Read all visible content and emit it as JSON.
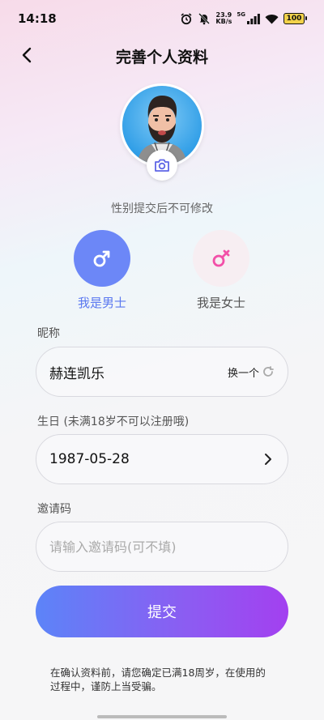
{
  "status_bar": {
    "time": "14:18",
    "net_speed_value": "23.9",
    "net_speed_unit": "KB/s",
    "network_type": "5G",
    "battery": "100"
  },
  "header": {
    "title": "完善个人资料",
    "back_icon": "chevron-left-icon"
  },
  "avatar": {
    "camera_icon": "camera-icon"
  },
  "gender": {
    "note": "性别提交后不可修改",
    "male_label": "我是男士",
    "female_label": "我是女士",
    "selected": "male",
    "male_color": "#6c87f7",
    "female_color": "#f24fa8"
  },
  "form": {
    "nickname": {
      "label": "昵称",
      "value": "赫连凯乐",
      "swap_label": "换一个"
    },
    "birthday": {
      "label": "生日 (未满18岁不可以注册哦)",
      "value": "1987-05-28"
    },
    "invite": {
      "label": "邀请码",
      "placeholder": "请输入邀请码(可不填)"
    }
  },
  "submit_label": "提交",
  "notice": "在确认资料前，请您确定已满18周岁，在使用的过程中，谨防上当受骗。"
}
